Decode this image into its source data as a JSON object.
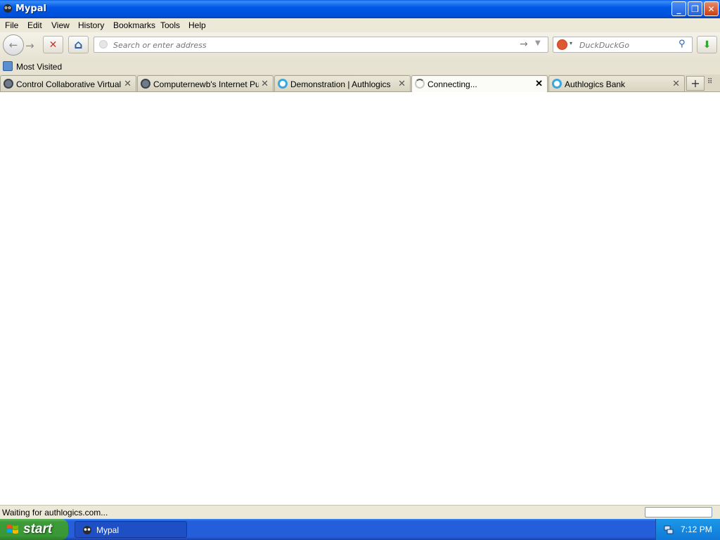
{
  "window": {
    "title": "Mypal",
    "minimize_glyph": "_",
    "maximize_glyph": "❐",
    "close_glyph": "✕"
  },
  "menubar": {
    "items": [
      "File",
      "Edit",
      "View",
      "History",
      "Bookmarks",
      "Tools",
      "Help"
    ]
  },
  "toolbar": {
    "back_icon": "back-arrow-icon",
    "forward_icon": "forward-arrow-icon",
    "stop_icon": "stop-x-icon",
    "home_icon": "home-icon",
    "download_icon": "download-arrow-icon",
    "stop_glyph": "✕",
    "home_glyph": "⌂",
    "download_glyph": "⬇",
    "stop_color": "#c0392b",
    "home_color": "#2a5db0",
    "download_color": "#2ea82e"
  },
  "address_bar": {
    "value": "",
    "placeholder": "Search or enter address",
    "go_glyph": "→",
    "dropdown_glyph": "▼"
  },
  "search_bar": {
    "engine": "DuckDuckGo",
    "value": "",
    "placeholder": "DuckDuckGo",
    "engine_dropdown_glyph": "▾",
    "search_glyph": "⚲"
  },
  "bookmarks_toolbar": {
    "items": [
      {
        "label": "Most Visited",
        "icon": "most-visited-icon"
      }
    ]
  },
  "tabs": [
    {
      "label": "Control Collaborative Virtual ...",
      "icon": "gear-icon",
      "active": false
    },
    {
      "label": "Computernewb's Internet Pu...",
      "icon": "gear-icon",
      "active": false
    },
    {
      "label": "Demonstration | Authlogics",
      "icon": "authlogics-icon",
      "active": false
    },
    {
      "label": "Connecting...",
      "icon": "loading-spinner-icon",
      "active": true
    },
    {
      "label": "Authlogics Bank",
      "icon": "authlogics-icon",
      "active": false
    }
  ],
  "tab_close_glyph": "✕",
  "new_tab_glyph": "+",
  "list_all_tabs_glyph": "⠿",
  "statusbar": {
    "text": "Waiting for authlogics.com..."
  },
  "taskbar": {
    "start_label": "start",
    "tasks": [
      {
        "label": "Mypal",
        "icon": "mypal-icon"
      }
    ],
    "clock": "7:12 PM",
    "colors": {
      "start_green": "#3c9a38",
      "taskbar_blue": "#245edb",
      "tray_blue": "#0f7ad8"
    }
  }
}
